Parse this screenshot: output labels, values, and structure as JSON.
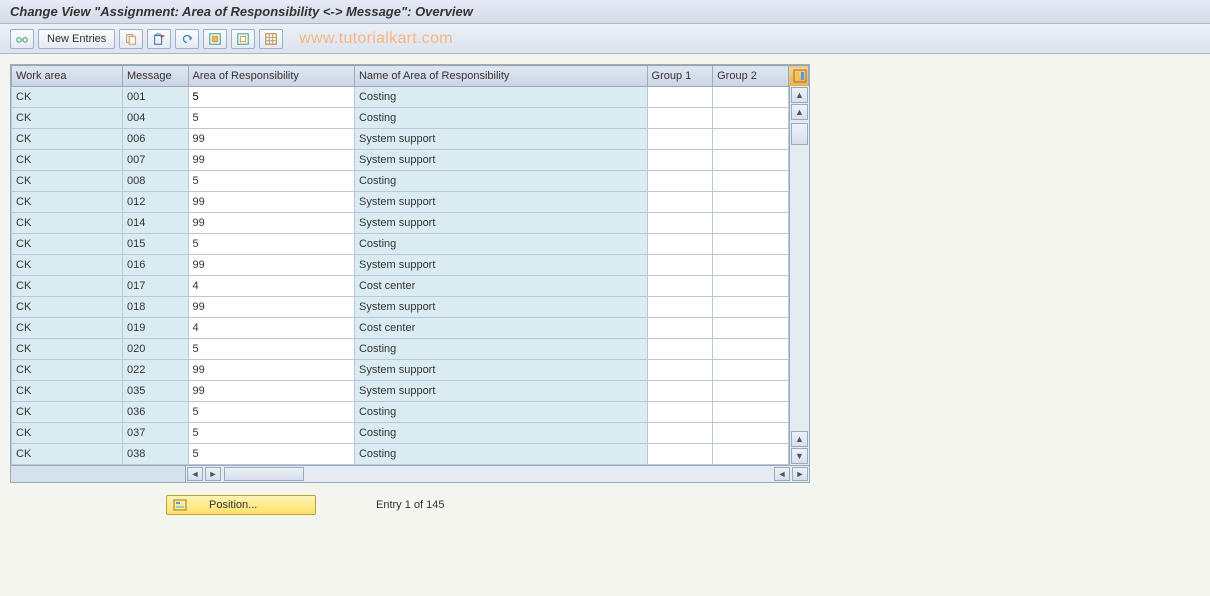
{
  "title": "Change View \"Assignment: Area of Responsibility <-> Message\": Overview",
  "toolbar": {
    "new_entries_label": "New Entries"
  },
  "watermark": "www.tutorialkart.com",
  "columns": {
    "work_area": "Work area",
    "message": "Message",
    "aor": "Area of Responsibility",
    "name": "Name of Area of Responsibility",
    "g1": "Group 1",
    "g2": "Group 2"
  },
  "rows": [
    {
      "work_area": "CK",
      "message": "001",
      "aor": "5",
      "name": "Costing",
      "g1": "",
      "g2": ""
    },
    {
      "work_area": "CK",
      "message": "004",
      "aor": "5",
      "name": "Costing",
      "g1": "",
      "g2": ""
    },
    {
      "work_area": "CK",
      "message": "006",
      "aor": "99",
      "name": "System support",
      "g1": "",
      "g2": ""
    },
    {
      "work_area": "CK",
      "message": "007",
      "aor": "99",
      "name": "System support",
      "g1": "",
      "g2": ""
    },
    {
      "work_area": "CK",
      "message": "008",
      "aor": "5",
      "name": "Costing",
      "g1": "",
      "g2": ""
    },
    {
      "work_area": "CK",
      "message": "012",
      "aor": "99",
      "name": "System support",
      "g1": "",
      "g2": ""
    },
    {
      "work_area": "CK",
      "message": "014",
      "aor": "99",
      "name": "System support",
      "g1": "",
      "g2": ""
    },
    {
      "work_area": "CK",
      "message": "015",
      "aor": "5",
      "name": "Costing",
      "g1": "",
      "g2": ""
    },
    {
      "work_area": "CK",
      "message": "016",
      "aor": "99",
      "name": "System support",
      "g1": "",
      "g2": ""
    },
    {
      "work_area": "CK",
      "message": "017",
      "aor": "4",
      "name": "Cost center",
      "g1": "",
      "g2": ""
    },
    {
      "work_area": "CK",
      "message": "018",
      "aor": "99",
      "name": "System support",
      "g1": "",
      "g2": ""
    },
    {
      "work_area": "CK",
      "message": "019",
      "aor": "4",
      "name": "Cost center",
      "g1": "",
      "g2": ""
    },
    {
      "work_area": "CK",
      "message": "020",
      "aor": "5",
      "name": "Costing",
      "g1": "",
      "g2": ""
    },
    {
      "work_area": "CK",
      "message": "022",
      "aor": "99",
      "name": "System support",
      "g1": "",
      "g2": ""
    },
    {
      "work_area": "CK",
      "message": "035",
      "aor": "99",
      "name": "System support",
      "g1": "",
      "g2": ""
    },
    {
      "work_area": "CK",
      "message": "036",
      "aor": "5",
      "name": "Costing",
      "g1": "",
      "g2": ""
    },
    {
      "work_area": "CK",
      "message": "037",
      "aor": "5",
      "name": "Costing",
      "g1": "",
      "g2": ""
    },
    {
      "work_area": "CK",
      "message": "038",
      "aor": "5",
      "name": "Costing",
      "g1": "",
      "g2": ""
    }
  ],
  "footer": {
    "position_label": "Position...",
    "entry_text": "Entry 1 of 145"
  }
}
